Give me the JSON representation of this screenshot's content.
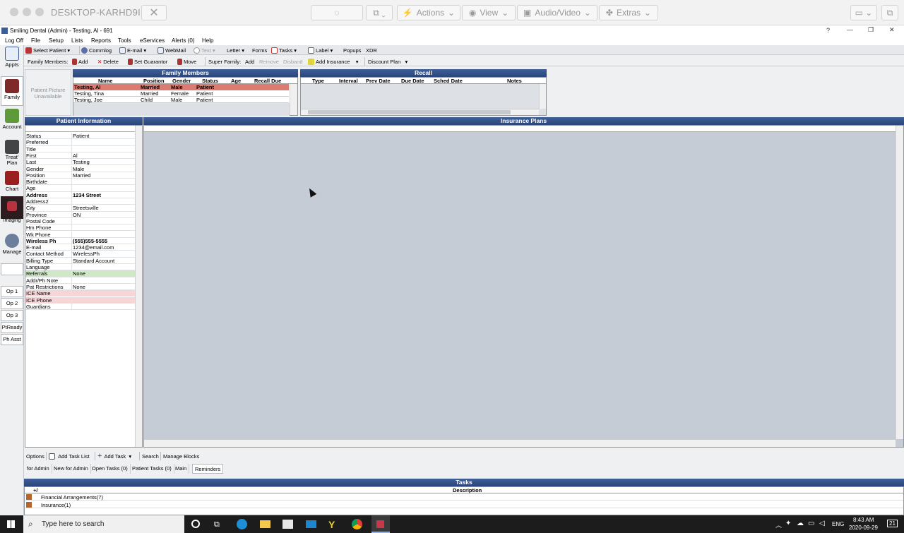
{
  "remote": {
    "machine": "DESKTOP-KARHD9I",
    "actions": "Actions",
    "view": "View",
    "audio_video": "Audio/Video",
    "extras": "Extras"
  },
  "app": {
    "title": "Smiling Dental (Admin) - Testing, Al - 691",
    "help": "?"
  },
  "menu": [
    "Log Off",
    "File",
    "Setup",
    "Lists",
    "Reports",
    "Tools",
    "eServices",
    "Alerts (0)",
    "Help"
  ],
  "toolbar1": {
    "select_patient": "Select Patient",
    "commlog": "Commlog",
    "email": "E-mail",
    "webmail": "WebMail",
    "text": "Text",
    "letter": "Letter",
    "forms": "Forms",
    "tasks": "Tasks",
    "label": "Label",
    "popups": "Popups",
    "xdr": "XDR"
  },
  "toolbar2": {
    "family_members": "Family Members:",
    "add": "Add",
    "delete": "Delete",
    "set_guarantor": "Set Guarantor",
    "move": "Move",
    "super_family": "Super Family:",
    "sf_add": "Add",
    "remove": "Remove",
    "disband": "Disband",
    "add_insurance": "Add Insurance",
    "discount_plan": "Discount Plan"
  },
  "sidebar": {
    "modules": [
      "Appts",
      "Family",
      "Account",
      "Treat' Plan",
      "Chart",
      "Imaging",
      "Manage"
    ],
    "ops": [
      "Op 1",
      "Op 2",
      "Op 3",
      "PtReady",
      "Ph Asst"
    ]
  },
  "patient_picture": "Patient Picture Unavailable",
  "family": {
    "title": "Family Members",
    "columns": [
      "Name",
      "Position",
      "Gender",
      "Status",
      "Age",
      "Recall Due"
    ],
    "rows": [
      [
        "Testing, Al",
        "Married",
        "Male",
        "Patient",
        "",
        ""
      ],
      [
        "Testing, Tina",
        "Married",
        "Female",
        "Patient",
        "",
        ""
      ],
      [
        "Testing, Joe",
        "Child",
        "Male",
        "Patient",
        "",
        ""
      ]
    ]
  },
  "recall": {
    "title": "Recall",
    "columns": [
      "Type",
      "Interval",
      "Prev Date",
      "Due Date",
      "Sched Date",
      "Notes"
    ]
  },
  "patient_info": {
    "title": "Patient Information",
    "rows": [
      [
        "Status",
        "Patient"
      ],
      [
        "Preferred",
        ""
      ],
      [
        "Title",
        ""
      ],
      [
        "First",
        "Al"
      ],
      [
        "Last",
        "Testing"
      ],
      [
        "Gender",
        "Male"
      ],
      [
        "Position",
        "Married"
      ],
      [
        "Birthdate",
        ""
      ],
      [
        "Age",
        ""
      ],
      [
        "Address",
        "1234 Street"
      ],
      [
        "Address2",
        ""
      ],
      [
        "City",
        "Streetsville"
      ],
      [
        "Province",
        "ON"
      ],
      [
        "Postal Code",
        ""
      ],
      [
        "Hm Phone",
        ""
      ],
      [
        "Wk Phone",
        ""
      ],
      [
        "Wireless Ph",
        "(555)555-5555"
      ],
      [
        "E-mail",
        "1234@email.com"
      ],
      [
        "Contact Method",
        "WirelessPh"
      ],
      [
        "Billing Type",
        "Standard Account"
      ],
      [
        "Language",
        ""
      ],
      [
        "Referrals",
        "None"
      ],
      [
        "Addr/Ph Note",
        ""
      ],
      [
        "Pat Restrictions",
        "None"
      ],
      [
        "ICE Name",
        ""
      ],
      [
        "ICE Phone",
        ""
      ],
      [
        "Guardians",
        ""
      ]
    ]
  },
  "insurance": {
    "title": "Insurance Plans"
  },
  "task_tools": {
    "options": "Options",
    "add_task_list": "Add Task List",
    "add_task": "Add Task",
    "search": "Search",
    "manage_blocks": "Manage Blocks"
  },
  "task_tabs": [
    "for Admin",
    "New for Admin",
    "Open Tasks (0)",
    "Patient Tasks (0)",
    "Main",
    "Reminders"
  ],
  "tasks": {
    "title": "Tasks",
    "col_plus": "+/",
    "col_desc": "Description",
    "rows": [
      "Financial Arrangements(7)",
      "Insurance(1)"
    ]
  },
  "win": {
    "search_placeholder": "Type here to search",
    "lang": "ENG",
    "time": "8:43 AM",
    "date": "2020-09-29",
    "notif": "21"
  }
}
